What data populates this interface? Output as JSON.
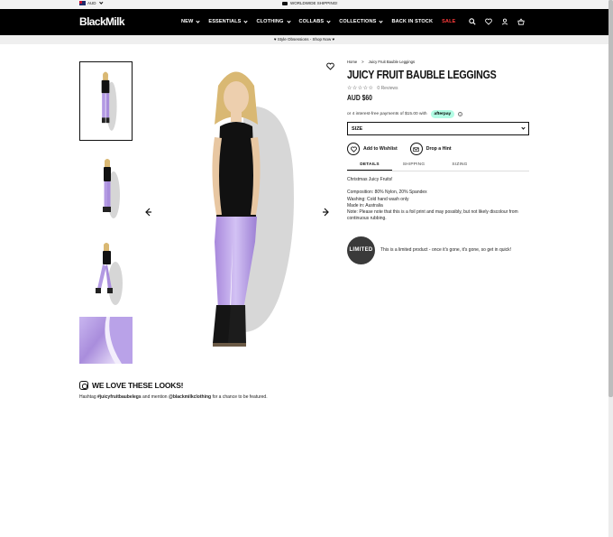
{
  "topbar": {
    "currency": "AUD",
    "shipping": "WORLDWIDE SHIPPING!"
  },
  "header": {
    "logo": "BlackMilk",
    "nav": [
      {
        "label": "NEW",
        "dropdown": true
      },
      {
        "label": "ESSENTIALS",
        "dropdown": true
      },
      {
        "label": "CLOTHING",
        "dropdown": true
      },
      {
        "label": "COLLABS",
        "dropdown": true
      },
      {
        "label": "COLLECTIONS",
        "dropdown": true
      },
      {
        "label": "BACK IN STOCK",
        "dropdown": false
      },
      {
        "label": "SALE",
        "dropdown": false
      }
    ],
    "icons": [
      "search-icon",
      "heart-icon",
      "user-icon",
      "basket-icon"
    ],
    "sale_color": "#ff3b3b"
  },
  "promo": {
    "text": "♥ Style Obsessions - Shop Now ♥"
  },
  "breadcrumb": [
    "Home",
    ">",
    "Juicy Fruit Bauble Leggings"
  ],
  "product": {
    "title": "JUICY FRUIT BAUBLE LEGGINGS",
    "stars": "☆☆☆☆☆",
    "reviews": "0 Reviews",
    "price": "AUD $60",
    "afterpay_text": "or 4 interest-free payments of $15.00 with",
    "afterpay_badge": "afterpay",
    "afterpay_color": "#b2fce4",
    "size_label": "SIZE",
    "add_to_wishlist": "Add to Wishlist",
    "drop_a_hint": "Drop a Hint"
  },
  "tabs": [
    "DETAILS",
    "SHIPPING",
    "SIZING"
  ],
  "details": {
    "intro": "Christmas Juicy Fruits!",
    "composition": "Composition: 80% Nylon, 20% Spandex",
    "washing": "Washing: Cold hand wash only",
    "made_in": "Made in: Australia",
    "note": "Note: Please note that this is a foil print and may possibly, but not likely discolour from continuous rubbing."
  },
  "limited": {
    "badge": "LIMITED",
    "text": "This is a limited product - once it's gone, it's gone, so get in quick!"
  },
  "looks": {
    "title": "WE LOVE THESE LOOKS!",
    "text_prefix": "Hashtag ",
    "hashtag": "#juicyfruitbaubelegs",
    "text_middle": " and mention ",
    "handle": "@blackmilkclothing",
    "text_suffix": " for a chance to be featured."
  }
}
